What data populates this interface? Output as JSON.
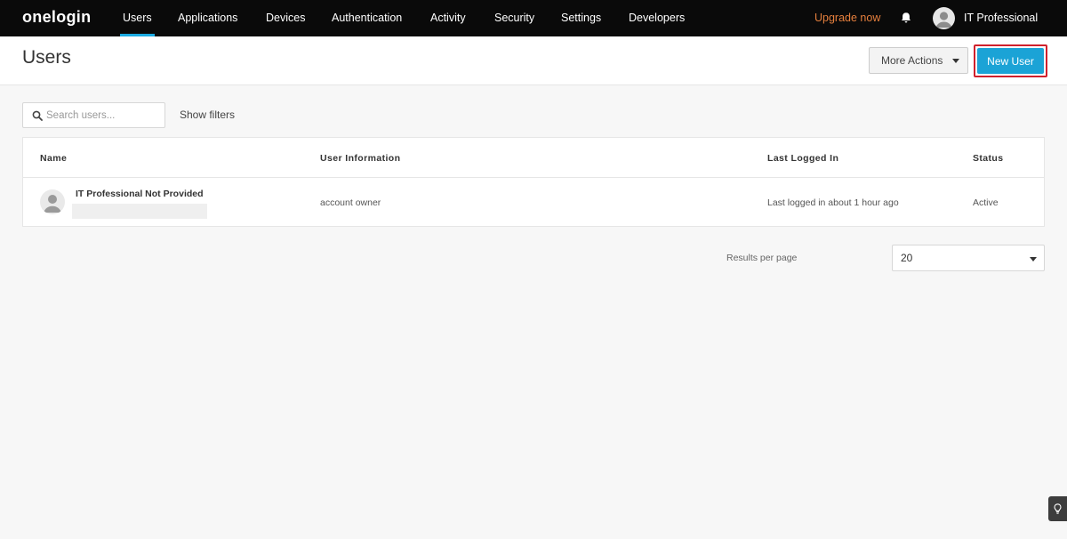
{
  "nav": {
    "logo": "onelogin",
    "items": [
      {
        "label": "Users",
        "active": true
      },
      {
        "label": "Applications",
        "active": false
      },
      {
        "label": "Devices",
        "active": false
      },
      {
        "label": "Authentication",
        "active": false
      },
      {
        "label": "Activity",
        "active": false
      },
      {
        "label": "Security",
        "active": false
      },
      {
        "label": "Settings",
        "active": false
      },
      {
        "label": "Developers",
        "active": false
      }
    ],
    "upgrade": "Upgrade now",
    "user_name": "IT Professional"
  },
  "header": {
    "title": "Users",
    "more_actions": "More Actions",
    "new_user": "New User"
  },
  "search": {
    "placeholder": "Search users...",
    "value": "",
    "show_filters": "Show filters"
  },
  "table": {
    "columns": [
      "Name",
      "User Information",
      "Last Logged In",
      "Status"
    ],
    "rows": [
      {
        "name": "IT Professional Not Provided",
        "user_info": "account owner",
        "last_logged_in": "Last logged in about 1 hour ago",
        "status": "Active"
      }
    ]
  },
  "pagination": {
    "results_per_page_label": "Results per page",
    "results_per_page": "20"
  },
  "colors": {
    "nav_bg": "#0a0a0a",
    "accent": "#1ba3d6",
    "upgrade": "#e57f3d",
    "highlight_border": "#d0202c"
  },
  "icons": {
    "search": "search-icon",
    "bell": "bell-icon",
    "avatar": "avatar-icon",
    "caret": "chevron-down-icon",
    "help": "lightbulb-icon"
  }
}
